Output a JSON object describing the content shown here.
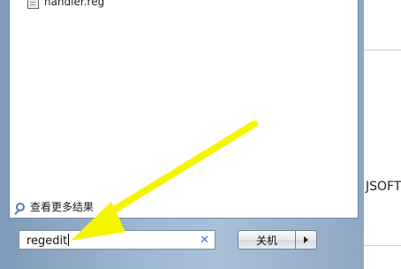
{
  "programs": {
    "items": [
      {
        "label": "handler.reg"
      }
    ]
  },
  "search_link": {
    "label": "查看更多结果"
  },
  "search": {
    "value": "regedit"
  },
  "shutdown": {
    "label": "关机"
  },
  "background": {
    "partial_text": "JSOFT"
  },
  "annotation": {
    "color": "#f5f500",
    "icon": "arrow-annotation"
  }
}
